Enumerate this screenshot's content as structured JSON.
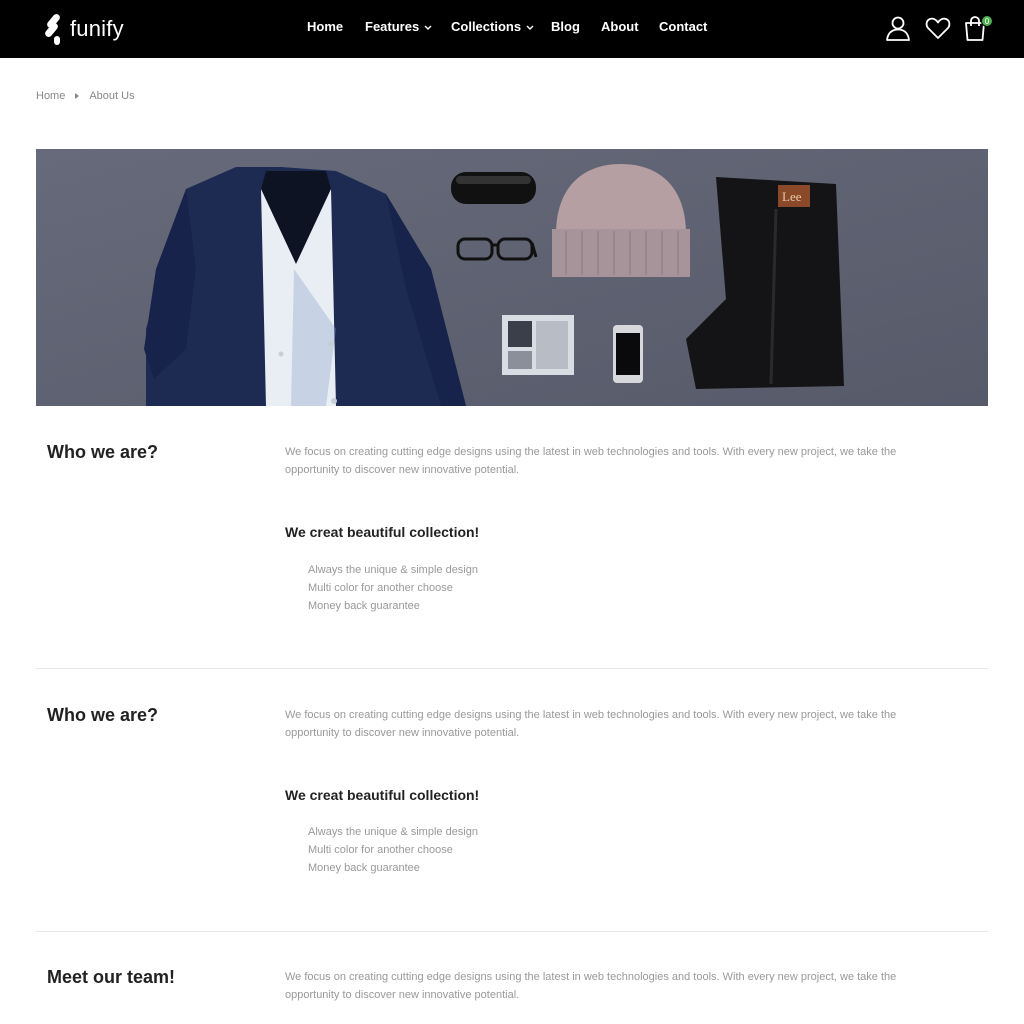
{
  "header": {
    "logo_text": "funify",
    "nav": [
      {
        "label": "Home"
      },
      {
        "label": "Features"
      },
      {
        "label": "Collections"
      },
      {
        "label": "Blog"
      },
      {
        "label": "About"
      },
      {
        "label": "Contact"
      }
    ],
    "cart_count": "0"
  },
  "breadcrumb": {
    "home": "Home",
    "current": "About Us"
  },
  "sections": [
    {
      "title": "Who we are?",
      "text": "We focus on creating cutting edge designs using the latest in web technologies and tools. With every new project, we take the opportunity to discover new innovative potential.",
      "subtitle": "We creat beautiful collection!",
      "list": [
        "Always the unique & simple design",
        "Multi color for another choose",
        "Money back guarantee"
      ]
    },
    {
      "title": "Who we are?",
      "text": "We focus on creating cutting edge designs using the latest in web technologies and tools. With every new project, we take the opportunity to discover new innovative potential.",
      "subtitle": "We creat beautiful collection!",
      "list": [
        "Always the unique & simple design",
        "Multi color for another choose",
        "Money back guarantee"
      ]
    },
    {
      "title": "Meet our team!",
      "text": "We focus on creating cutting edge designs using the latest in web technologies and tools. With every new project, we take the opportunity to discover new innovative potential."
    }
  ],
  "hero": {
    "label_text": "Lee"
  },
  "colors": {
    "header_bg": "#000000",
    "accent": "#4caf50",
    "hero_bg": "#5f6373"
  }
}
